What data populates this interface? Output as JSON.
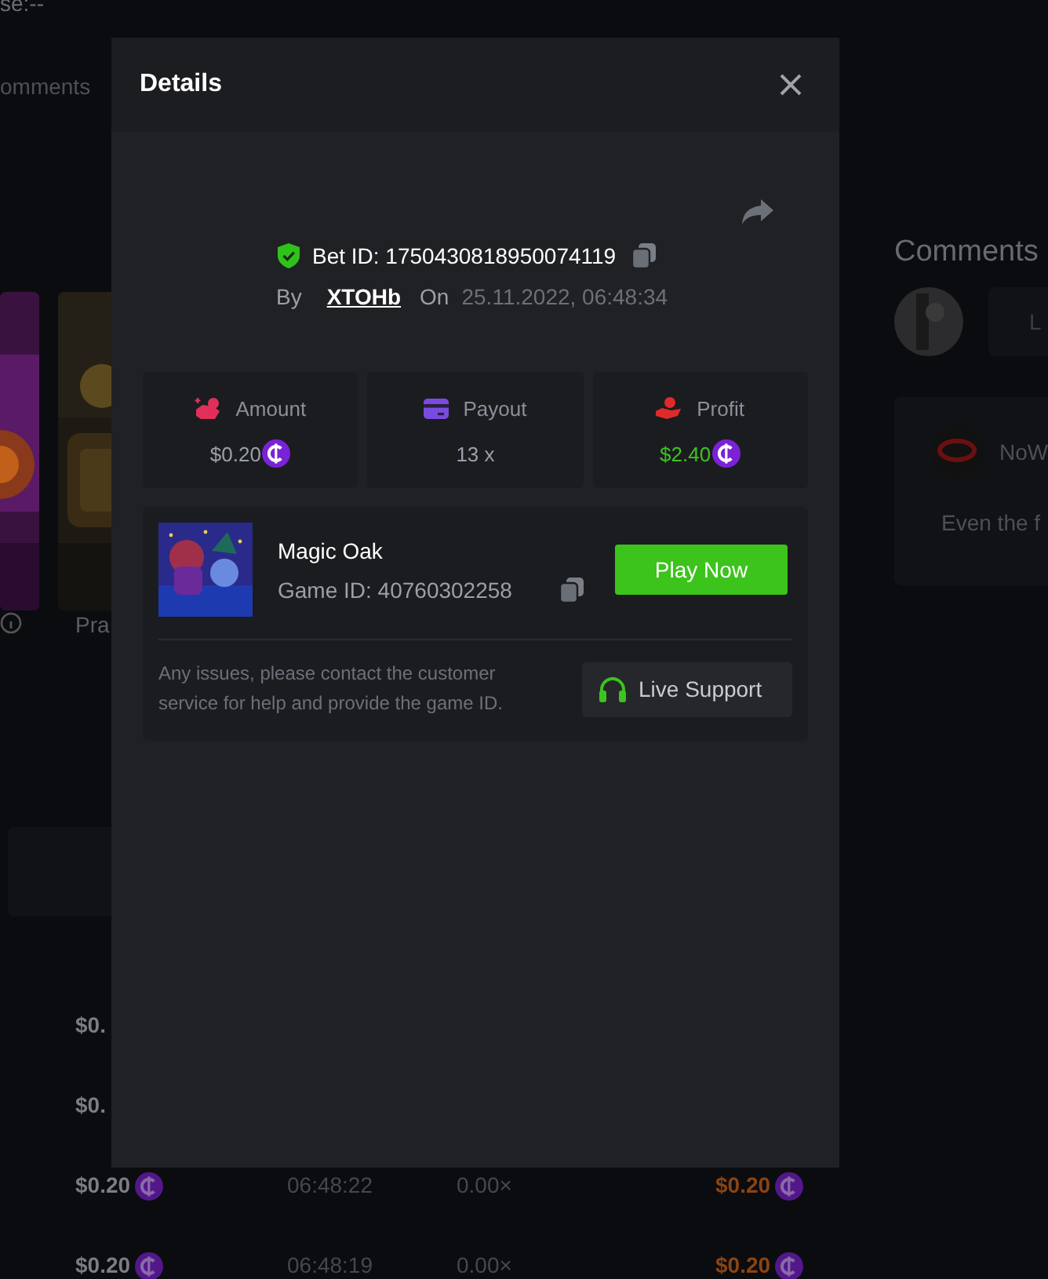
{
  "background": {
    "status_text": "se:--",
    "tab_label": "omments",
    "game_caption": "Pra",
    "comments_title": "Comments",
    "comment_input_placeholder": "L",
    "comment": {
      "author": "NoW",
      "text": "Even the f"
    },
    "rows": [
      {
        "amount": "$0."
      },
      {
        "amount": "$0."
      },
      {
        "amount": "$0.20",
        "time": "06:48:22",
        "multiplier": "0.00×",
        "payout": "$0.20"
      },
      {
        "amount": "$0.20",
        "time": "06:48:19",
        "multiplier": "0.00×",
        "payout": "$0.20"
      }
    ]
  },
  "modal": {
    "title": "Details",
    "bet_id": "Bet ID: 1750430818950074119",
    "by_label": "By",
    "user": "XTOHb",
    "on_label": "On",
    "date": "25.11.2022, 06:48:34",
    "stats": [
      {
        "kind": "amount",
        "label": "Amount",
        "value": "$0.20",
        "coin": true
      },
      {
        "kind": "payout",
        "label": "Payout",
        "value": "13 x",
        "coin": false
      },
      {
        "kind": "profit",
        "label": "Profit",
        "value": "$2.40",
        "coin": true
      }
    ],
    "game": {
      "name": "Magic Oak",
      "game_id": "Game ID: 40760302258",
      "play_button": "Play Now"
    },
    "support": {
      "note": "Any issues, please contact the customer service for help and provide the game ID.",
      "button": "Live Support"
    }
  }
}
